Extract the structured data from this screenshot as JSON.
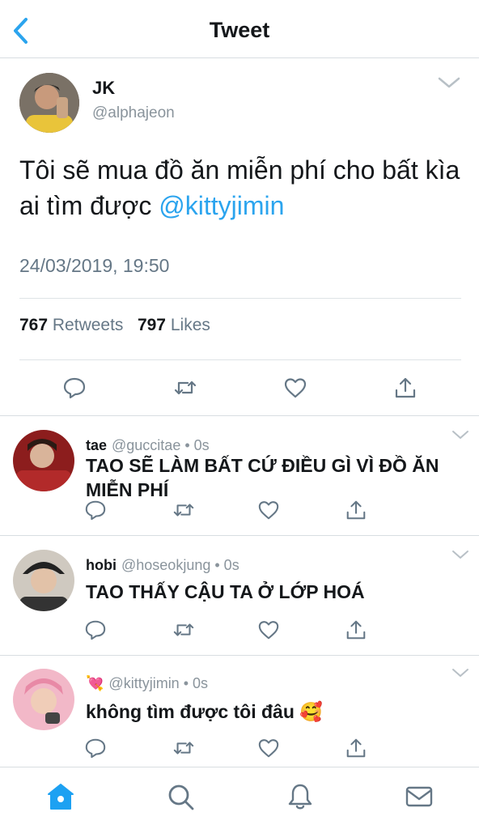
{
  "header": {
    "title": "Tweet"
  },
  "main_tweet": {
    "author_name": "JK",
    "author_handle": "@alphajeon",
    "text_part1": "Tôi sẽ mua đồ ăn miễn phí cho bất kìa ai tìm được ",
    "mention": "@kittyjimin",
    "timestamp": "24/03/2019, 19:50",
    "retweets_count": "767",
    "retweets_label": "Retweets",
    "likes_count": "797",
    "likes_label": "Likes"
  },
  "replies": [
    {
      "name": "tae",
      "handle": "@guccitae",
      "time": "• 0s",
      "text": "TAO SẼ LÀM BẤT CỨ ĐIỀU GÌ VÌ ĐỒ ĂN MIỄN PHÍ"
    },
    {
      "name": "hobi",
      "handle": "@hoseokjung",
      "time": "• 0s",
      "text": "TAO THẤY CẬU TA Ở LỚP HOÁ"
    },
    {
      "name": "💘",
      "handle": "@kittyjimin",
      "time": "• 0s",
      "text": "không tìm được tôi đâu 🥰"
    }
  ],
  "icons": {
    "back": "chevron-left-icon",
    "caret": "chevron-down-icon",
    "reply": "reply-icon",
    "retweet": "retweet-icon",
    "like": "heart-icon",
    "share": "share-icon",
    "home": "home-icon",
    "search": "search-icon",
    "notifications": "bell-icon",
    "messages": "mail-icon"
  },
  "colors": {
    "accent": "#1da1f2",
    "mention": "#2ba4ee",
    "muted": "#657786"
  }
}
